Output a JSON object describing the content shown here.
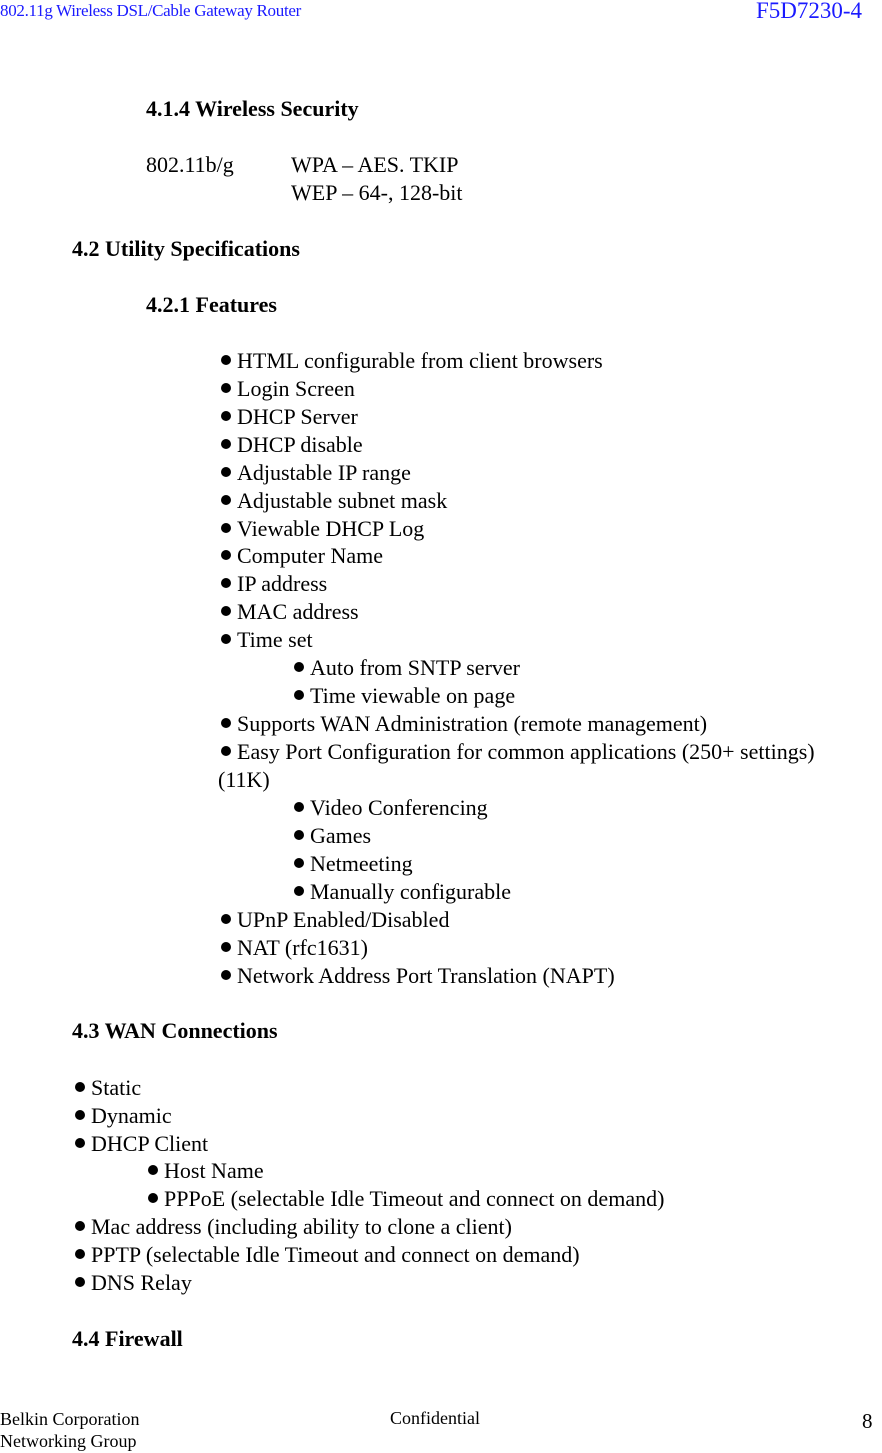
{
  "header": {
    "doc_title": "802.11g Wireless DSL/Cable Gateway Router",
    "model": "F5D7230-4"
  },
  "section_414": {
    "heading": "4.1.4 Wireless Security",
    "standard": "802.11b/g",
    "values": [
      "WPA – AES. TKIP",
      "WEP – 64-, 128-bit"
    ]
  },
  "section_42": {
    "heading": "4.2 Utility Specifications",
    "sub_heading": "4.2.1 Features",
    "features": [
      "HTML configurable from client browsers",
      "Login Screen",
      "DHCP Server",
      "DHCP disable",
      "Adjustable IP range",
      "Adjustable subnet mask",
      "Viewable DHCP Log",
      "Computer Name",
      "IP address",
      "MAC address",
      "Time set"
    ],
    "time_set_sub": [
      "Auto from SNTP server",
      "Time viewable on page"
    ],
    "wan_admin": "Supports WAN Administration (remote management)",
    "easy_port": "Easy Port Configuration for common applications (250+ settings)",
    "easy_port_cont": "(11K)",
    "easy_port_sub": [
      "Video Conferencing",
      "Games",
      "Netmeeting",
      "Manually configurable"
    ],
    "tail": [
      "UPnP Enabled/Disabled",
      "NAT (rfc1631)",
      "Network Address Port Translation (NAPT)"
    ]
  },
  "section_43": {
    "heading": "4.3 WAN Connections",
    "items": [
      "Static",
      "Dynamic",
      "DHCP Client"
    ],
    "dhcp_sub": [
      "Host Name",
      "PPPoE (selectable Idle Timeout and connect on demand)"
    ],
    "tail": [
      "Mac address (including ability to clone a client)",
      "PPTP (selectable Idle Timeout and connect on demand)",
      "DNS Relay"
    ]
  },
  "section_44": {
    "heading": "4.4 Firewall"
  },
  "footer": {
    "company": "Belkin Corporation",
    "group": "Networking Group",
    "confidential": "Confidential",
    "page_number": "8"
  }
}
